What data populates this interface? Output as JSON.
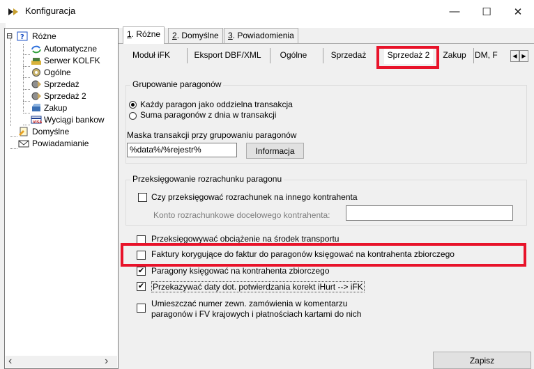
{
  "window": {
    "title": "Konfiguracja",
    "controls": [
      "—",
      "☐",
      "✕"
    ]
  },
  "tree": {
    "items": [
      {
        "label": "Różne",
        "expander": "⊟",
        "icon": "help-folder-icon"
      },
      {
        "label": "Automatyczne",
        "icon": "refresh-arrows-icon"
      },
      {
        "label": "Serwer KOLFK",
        "icon": "server-icon"
      },
      {
        "label": "Ogólne",
        "icon": "gear-icon"
      },
      {
        "label": "Sprzedaż",
        "icon": "sales-icon"
      },
      {
        "label": "Sprzedaż 2",
        "icon": "sales-icon"
      },
      {
        "label": "Zakup",
        "icon": "purchase-icon"
      },
      {
        "label": "Wyciągi bankow",
        "icon": "bank-card-icon"
      },
      {
        "label": "Domyślne",
        "icon": "document-icon"
      },
      {
        "label": "Powiadamianie",
        "icon": "envelope-icon"
      }
    ],
    "scroll_left": "‹",
    "scroll_right": "›"
  },
  "tabs": [
    {
      "num": "1",
      "label": ". Różne"
    },
    {
      "num": "2",
      "label": ". Domyślne"
    },
    {
      "num": "3",
      "label": ". Powiadomienia"
    }
  ],
  "subtabs": [
    "Moduł iFK",
    "Eksport DBF/XML",
    "Ogólne",
    "Sprzedaż",
    "Sprzedaż 2",
    "Zakup",
    "DM, F"
  ],
  "subtab_scroll": {
    "left": "◀",
    "right": "▶"
  },
  "grouping": {
    "legend": "Grupowanie paragonów",
    "radio1": "Każdy paragon jako oddzielna transakcja",
    "radio2": "Suma paragonów z dnia w transakcji",
    "selected": 1,
    "mask_label": "Maska transakcji przy grupowaniu paragonów",
    "mask_value": "%data%/%rejestr%",
    "info_button": "Informacja"
  },
  "repost": {
    "legend": "Przeksięgowanie rozrachunku paragonu",
    "checkbox_label": "Czy przeksięgować rozrachunek na innego kontrahenta",
    "account_label": "Konto rozrachunkowe docelowego kontrahenta:",
    "account_value": ""
  },
  "options": [
    {
      "label": "Przeksięgowywać obciążenie na środek transportu",
      "checked": false
    },
    {
      "label": "Faktury korygujące do faktur do paragonów księgować na kontrahenta zbiorczego",
      "checked": false
    },
    {
      "label": "Paragony księgować na kontrahenta zbiorczego",
      "checked": true
    },
    {
      "label": "Przekazywać daty dot. potwierdzania korekt iHurt --> iFK",
      "checked": true
    },
    {
      "label": "Umieszczać numer zewn. zamówienia w komentarzu",
      "label2": "paragonów i FV krajowych i płatnościach kartami do nich",
      "checked": false
    }
  ],
  "save_button": "Zapisz",
  "colors": {
    "highlight": "#e8132a",
    "panel": "#f0f0f0"
  }
}
